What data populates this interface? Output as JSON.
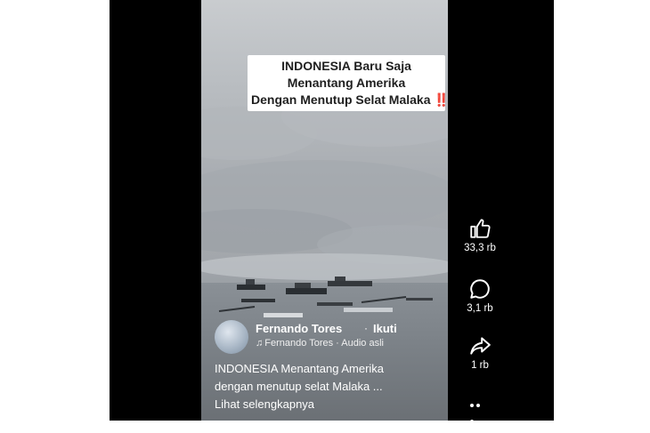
{
  "video": {
    "title_lines": [
      "INDONESIA Baru Saja",
      "Menantang Amerika",
      "Dengan Menutup Selat Malaka"
    ],
    "title_emoji": "‼️",
    "author": "Fernando Tores",
    "follow_label": "Ikuti",
    "audio_label": "Fernando Tores · Audio asli",
    "caption_lines": [
      "INDONESIA Menantang Amerika",
      "dengan menutup selat Malaka ...",
      "Lihat selengkapnya"
    ]
  },
  "actions": {
    "likes": "33,3 rb",
    "comments": "3,1 rb",
    "shares": "1 rb"
  },
  "icons": {
    "like": "thumbs-up-icon",
    "comment": "comment-icon",
    "share": "share-icon",
    "more": "more-icon",
    "audio": "music-note-icon"
  },
  "colors": {
    "background": "#000000",
    "emoji": "#d3192a"
  }
}
